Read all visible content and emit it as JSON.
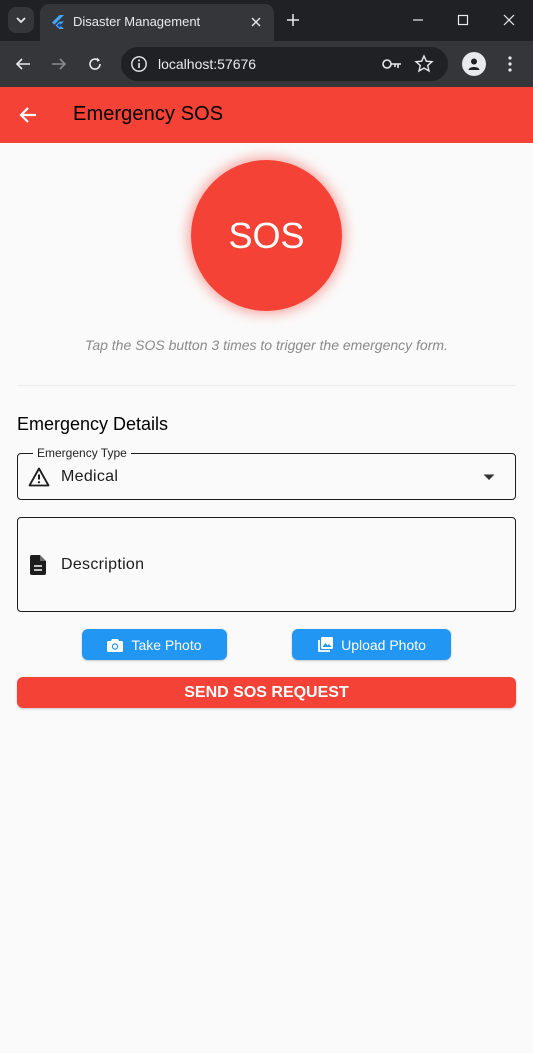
{
  "browser": {
    "tab_title": "Disaster Management",
    "url": "localhost:57676"
  },
  "appbar": {
    "title": "Emergency SOS"
  },
  "sos": {
    "button_label": "SOS",
    "hint": "Tap the SOS button 3 times to trigger the emergency form."
  },
  "form": {
    "section_title": "Emergency Details",
    "emergency_type": {
      "label": "Emergency Type",
      "value": "Medical",
      "icon": "warning-icon"
    },
    "description": {
      "placeholder": "Description",
      "icon": "document-icon"
    },
    "take_photo_label": "Take Photo",
    "upload_photo_label": "Upload Photo",
    "send_label": "SEND SOS REQUEST"
  },
  "colors": {
    "primary_red": "#f44336",
    "accent_blue": "#2196f3",
    "background": "#fafafa"
  }
}
